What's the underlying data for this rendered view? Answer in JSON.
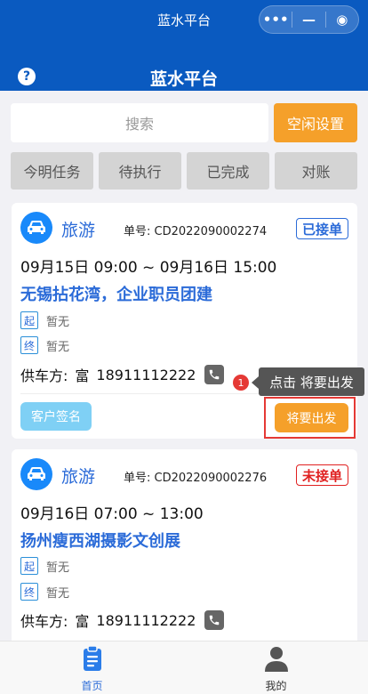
{
  "app": {
    "mp_title": "蓝水平台",
    "page_title": "蓝水平台",
    "capsule": {
      "more": "•••",
      "minimize": "—",
      "close": "◉"
    }
  },
  "search": {
    "placeholder": "搜索",
    "idle_button": "空闲设置"
  },
  "tabs": [
    {
      "label": "今明任务"
    },
    {
      "label": "待执行"
    },
    {
      "label": "已完成"
    },
    {
      "label": "对账"
    }
  ],
  "orders": [
    {
      "type": "旅游",
      "order_no": "单号:  CD2022090002274",
      "status": "已接单",
      "time": "09月15日 09:00 ~ 09月16日 15:00",
      "route": "无锡拈花湾，企业职员团建",
      "start_tag": "起",
      "start": "暂无",
      "end_tag": "终",
      "end": "暂无",
      "supplier_label": "供车方:",
      "supplier_name": "富",
      "phone": "18911112222",
      "sign_button": "客户签名",
      "depart_button": "将要出发"
    },
    {
      "type": "旅游",
      "order_no": "单号:  CD2022090002276",
      "status": "未接单",
      "time": "09月16日 07:00 ~ 13:00",
      "route": "扬州瘦西湖摄影文创展",
      "start_tag": "起",
      "start": "暂无",
      "end_tag": "终",
      "end": "暂无",
      "supplier_label": "供车方:",
      "supplier_name": "富",
      "phone": "18911112222"
    }
  ],
  "tooltip": {
    "step": "1",
    "text": "点击 将要出发"
  },
  "bottom_nav": [
    {
      "label": "首页",
      "icon": "clipboard-icon",
      "active": true
    },
    {
      "label": "我的",
      "icon": "user-icon",
      "active": false
    }
  ],
  "colors": {
    "header_blue": "#0a5ac0",
    "accent_blue": "#2b6bd8",
    "orange": "#f5a02a",
    "red": "#e53935"
  }
}
